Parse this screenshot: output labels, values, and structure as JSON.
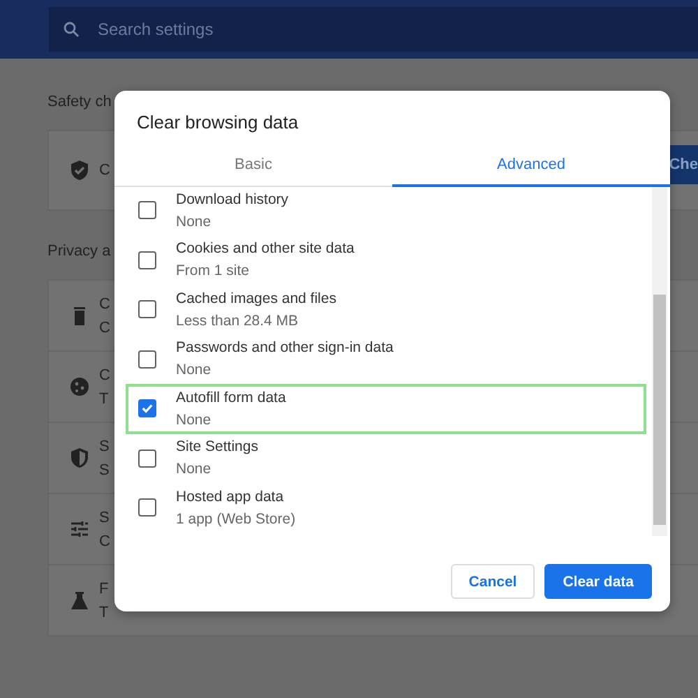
{
  "header": {
    "search": {
      "placeholder": "Search settings"
    }
  },
  "sections": [
    {
      "title": "Safety ch",
      "action": "Che",
      "rows": [
        {
          "kind": "shield-check",
          "line1": "C"
        }
      ]
    },
    {
      "title": "Privacy a",
      "rows": [
        {
          "kind": "trash",
          "line1": "C",
          "line2": "C"
        },
        {
          "kind": "cookie",
          "line1": "C",
          "line2": "T"
        },
        {
          "kind": "shield-half",
          "line1": "S",
          "line2": "S"
        },
        {
          "kind": "sliders",
          "line1": "S",
          "line2": "C"
        },
        {
          "kind": "flask",
          "line1": "F",
          "line2": "T"
        }
      ]
    }
  ],
  "dialog": {
    "title": "Clear browsing data",
    "tabs": [
      {
        "label": "Basic",
        "selected": false
      },
      {
        "label": "Advanced",
        "selected": true
      }
    ],
    "items": [
      {
        "label": "Download history",
        "detail": "None",
        "checked": false,
        "highlighted": false
      },
      {
        "label": "Cookies and other site data",
        "detail": "From 1 site",
        "checked": false,
        "highlighted": false
      },
      {
        "label": "Cached images and files",
        "detail": "Less than 28.4 MB",
        "checked": false,
        "highlighted": false
      },
      {
        "label": "Passwords and other sign-in data",
        "detail": "None",
        "checked": false,
        "highlighted": false
      },
      {
        "label": "Autofill form data",
        "detail": "None",
        "checked": true,
        "highlighted": true
      },
      {
        "label": "Site Settings",
        "detail": "None",
        "checked": false,
        "highlighted": false
      },
      {
        "label": "Hosted app data",
        "detail": "1 app (Web Store)",
        "checked": false,
        "highlighted": false
      }
    ],
    "buttons": [
      {
        "label": "Cancel",
        "kind": "secondary"
      },
      {
        "label": "Clear data",
        "kind": "primary"
      }
    ]
  }
}
